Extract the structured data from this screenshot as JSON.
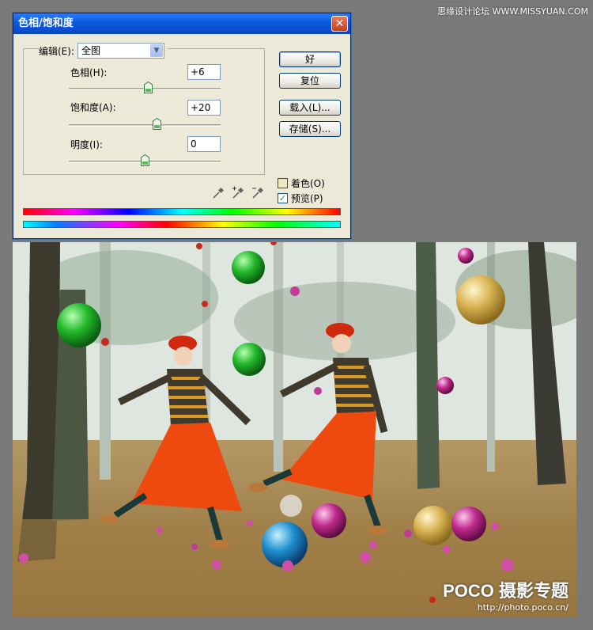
{
  "site_watermark": "思缘设计论坛 WWW.MISSYUAN.COM",
  "dialog": {
    "title": "色相/饱和度",
    "close_symbol": "✕",
    "edit_label": "编辑(E):",
    "edit_value": "全图",
    "hue_label": "色相(H):",
    "hue_value": "+6",
    "hue_level": 0.52,
    "saturation_label": "饱和度(A):",
    "saturation_value": "+20",
    "saturation_level": 0.58,
    "lightness_label": "明度(I):",
    "lightness_value": "0",
    "lightness_level": 0.5,
    "ok_label": "好",
    "reset_label": "复位",
    "load_label": "载入(L)...",
    "save_label": "存储(S)...",
    "colorize_label": "着色(O)",
    "colorize_checked": false,
    "preview_label": "预览(P)",
    "preview_checked": true
  },
  "photo": {
    "watermark_logo": "POCO 摄影专题",
    "watermark_url": "http://photo.poco.cn/"
  }
}
